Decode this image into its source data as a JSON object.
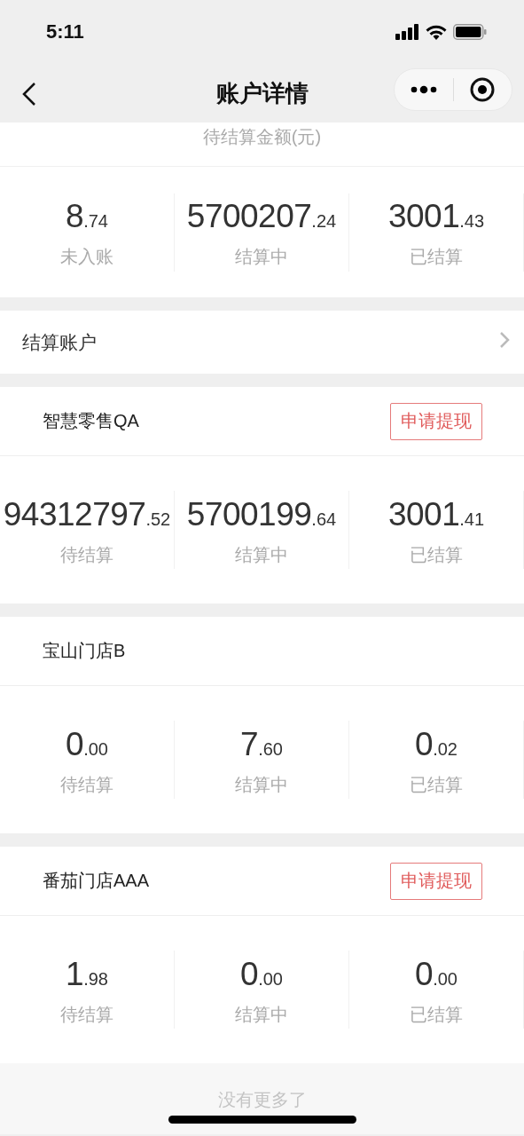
{
  "status_bar": {
    "time": "5:11"
  },
  "nav": {
    "title": "账户详情"
  },
  "summary": {
    "title": "待结算金额(元)",
    "stats": [
      {
        "integer": "8",
        "decimal": ".74",
        "label": "未入账"
      },
      {
        "integer": "5700207",
        "decimal": ".24",
        "label": "结算中"
      },
      {
        "integer": "3001",
        "decimal": ".43",
        "label": "已结算"
      }
    ]
  },
  "settlement_account": {
    "label": "结算账户"
  },
  "stores": [
    {
      "name": "智慧零售QA",
      "withdraw_button": "申请提现",
      "stats": [
        {
          "integer": "94312797",
          "decimal": ".52",
          "label": "待结算"
        },
        {
          "integer": "5700199",
          "decimal": ".64",
          "label": "结算中"
        },
        {
          "integer": "3001",
          "decimal": ".41",
          "label": "已结算"
        }
      ]
    },
    {
      "name": "宝山门店B",
      "stats": [
        {
          "integer": "0",
          "decimal": ".00",
          "label": "待结算"
        },
        {
          "integer": "7",
          "decimal": ".60",
          "label": "结算中"
        },
        {
          "integer": "0",
          "decimal": ".02",
          "label": "已结算"
        }
      ]
    },
    {
      "name": "番茄门店AAA",
      "withdraw_button": "申请提现",
      "stats": [
        {
          "integer": "1",
          "decimal": ".98",
          "label": "待结算"
        },
        {
          "integer": "0",
          "decimal": ".00",
          "label": "结算中"
        },
        {
          "integer": "0",
          "decimal": ".00",
          "label": "已结算"
        }
      ]
    }
  ],
  "footer": {
    "text": "没有更多了"
  }
}
